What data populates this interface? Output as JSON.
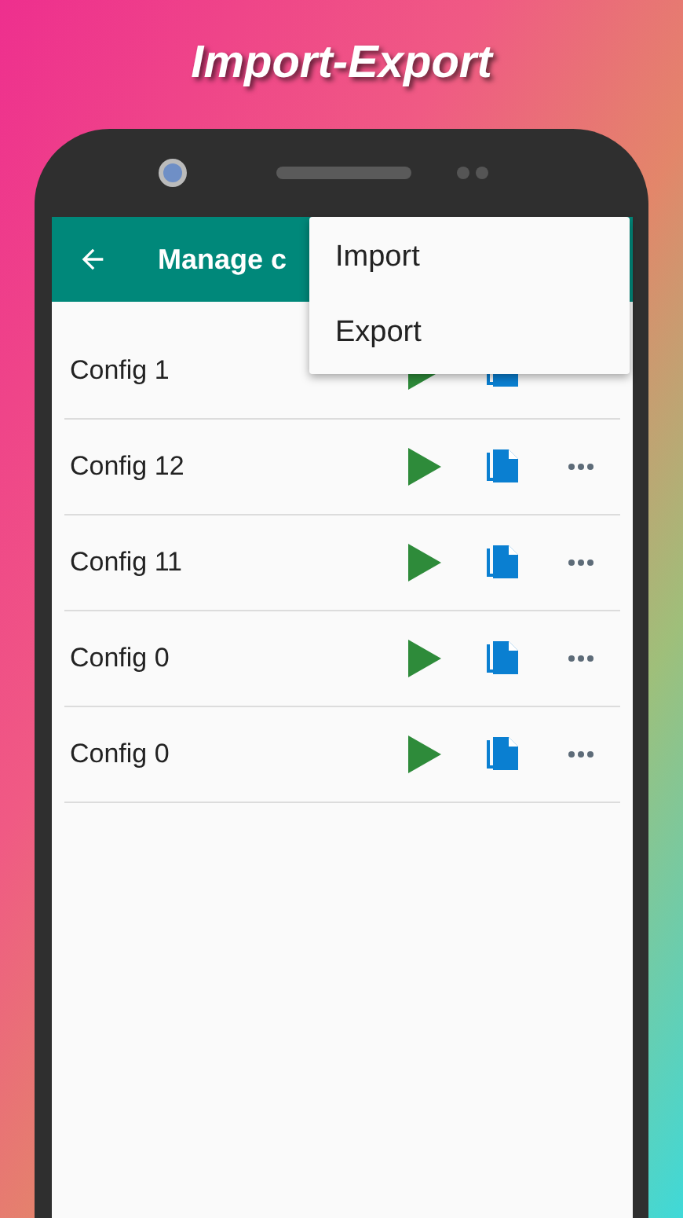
{
  "headline": "Import-Export",
  "toolbar": {
    "title": "Manage c"
  },
  "menu": {
    "open": true,
    "items": [
      {
        "label": "Import"
      },
      {
        "label": "Export"
      }
    ]
  },
  "configs": [
    {
      "name": "Config 1"
    },
    {
      "name": "Config 12"
    },
    {
      "name": "Config 11"
    },
    {
      "name": "Config 0"
    },
    {
      "name": "Config 0"
    }
  ]
}
